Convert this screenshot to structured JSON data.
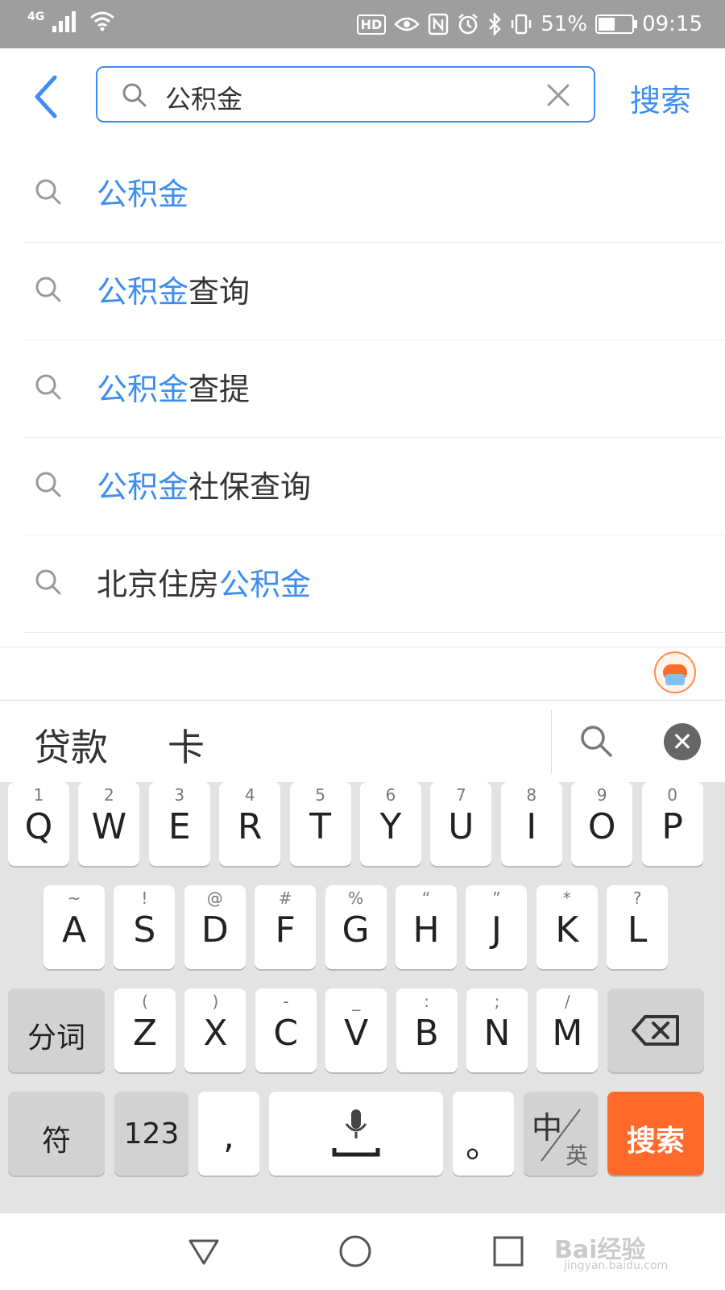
{
  "status_bar": {
    "network": "4G",
    "hd_label": "HD",
    "battery_percent": "51%",
    "battery_level": 0.51,
    "time": "09:15"
  },
  "header": {
    "query": "公积金",
    "search_button": "搜索"
  },
  "suggestions": [
    {
      "pre": "",
      "hl": "公积金",
      "post": ""
    },
    {
      "pre": "",
      "hl": "公积金",
      "post": "查询"
    },
    {
      "pre": "",
      "hl": "公积金",
      "post": "查提"
    },
    {
      "pre": "",
      "hl": "公积金",
      "post": "社保查询"
    },
    {
      "pre": "北京住房",
      "hl": "公积金",
      "post": ""
    }
  ],
  "candidates": [
    "贷款",
    "卡"
  ],
  "keyboard": {
    "row1": [
      {
        "main": "Q",
        "sub": "1"
      },
      {
        "main": "W",
        "sub": "2"
      },
      {
        "main": "E",
        "sub": "3"
      },
      {
        "main": "R",
        "sub": "4"
      },
      {
        "main": "T",
        "sub": "5"
      },
      {
        "main": "Y",
        "sub": "6"
      },
      {
        "main": "U",
        "sub": "7"
      },
      {
        "main": "I",
        "sub": "8"
      },
      {
        "main": "O",
        "sub": "9"
      },
      {
        "main": "P",
        "sub": "0"
      }
    ],
    "row2": [
      {
        "main": "A",
        "sub": "~"
      },
      {
        "main": "S",
        "sub": "!"
      },
      {
        "main": "D",
        "sub": "@"
      },
      {
        "main": "F",
        "sub": "#"
      },
      {
        "main": "G",
        "sub": "%"
      },
      {
        "main": "H",
        "sub": "“"
      },
      {
        "main": "J",
        "sub": "”"
      },
      {
        "main": "K",
        "sub": "*"
      },
      {
        "main": "L",
        "sub": "?"
      }
    ],
    "row3": [
      {
        "main": "Z",
        "sub": "("
      },
      {
        "main": "X",
        "sub": ")"
      },
      {
        "main": "C",
        "sub": "-"
      },
      {
        "main": "V",
        "sub": "_"
      },
      {
        "main": "B",
        "sub": ":"
      },
      {
        "main": "N",
        "sub": ";"
      },
      {
        "main": "M",
        "sub": "/"
      }
    ],
    "segment_key": "分词",
    "symbol_key": "符",
    "number_key": "123",
    "comma_key": ",",
    "period_key": "。",
    "lang_key_main": "中",
    "lang_key_sub": "英",
    "search_key": "搜索"
  },
  "watermark": {
    "logo": "Bai经验",
    "url": "jingyan.baidu.com"
  },
  "colors": {
    "accent": "#3d8ef0",
    "search_key": "#ff6a2a",
    "status_bar": "#9e9e9e"
  }
}
